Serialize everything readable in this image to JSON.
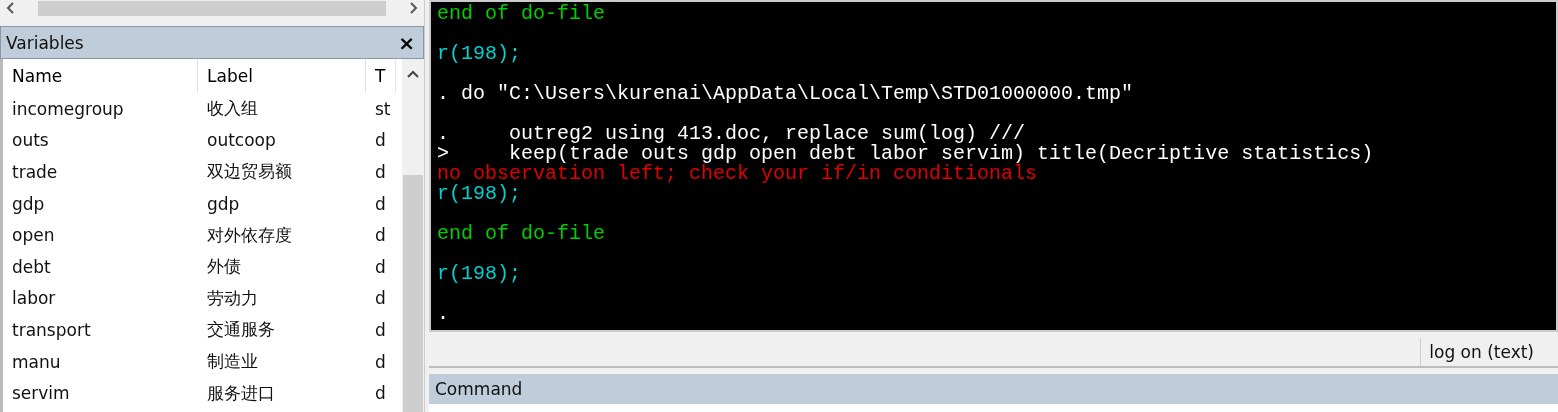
{
  "variables_panel": {
    "title": "Variables",
    "close": "×",
    "columns": [
      "Name",
      "Label",
      "T"
    ],
    "rows": [
      {
        "name": "incomegroup",
        "label": "收入组",
        "column_3": "st"
      },
      {
        "name": "outs",
        "label": "outcoop",
        "column_3": "d"
      },
      {
        "name": "trade",
        "label": "双边贸易额",
        "column_3": "d"
      },
      {
        "name": "gdp",
        "label": "gdp",
        "column_3": "d"
      },
      {
        "name": "open",
        "label": "对外依存度",
        "column_3": "d"
      },
      {
        "name": "debt",
        "label": "外债",
        "column_3": "d"
      },
      {
        "name": "labor",
        "label": "劳动力",
        "column_3": "d"
      },
      {
        "name": "transport",
        "label": "交通服务",
        "column_3": "d"
      },
      {
        "name": "manu",
        "label": "制造业",
        "column_3": "d"
      },
      {
        "name": "servim",
        "label": "服务进口",
        "column_3": "d"
      }
    ]
  },
  "results": [
    {
      "lines": [
        {
          "kind": "result",
          "text": "end of do-file"
        }
      ]
    },
    {
      "lines": [
        {
          "kind": "return",
          "text": "r(198);"
        }
      ]
    },
    {
      "lines": [
        {
          "kind": "command",
          "text": ". do \"C:\\Users\\kurenai\\AppData\\Local\\Temp\\STD01000000.tmp\""
        }
      ]
    },
    {
      "lines": [
        {
          "kind": "command",
          "text": ".     outreg2 using 413.doc, replace sum(log) ///"
        },
        {
          "kind": "command",
          "text": ">     keep(trade outs gdp open debt labor servim) title(Decriptive statistics)"
        },
        {
          "kind": "error",
          "text": "no observation left; check your if/in conditionals"
        },
        {
          "kind": "return",
          "text": "r(198);"
        }
      ]
    },
    {
      "lines": [
        {
          "kind": "result",
          "text": "end of do-file"
        }
      ]
    },
    {
      "lines": [
        {
          "kind": "return",
          "text": "r(198);"
        }
      ]
    },
    {
      "lines": [
        {
          "kind": "command",
          "text": "."
        }
      ]
    }
  ],
  "status_bar": {
    "log": "log on (text)"
  },
  "command_panel": {
    "title": "Command"
  }
}
